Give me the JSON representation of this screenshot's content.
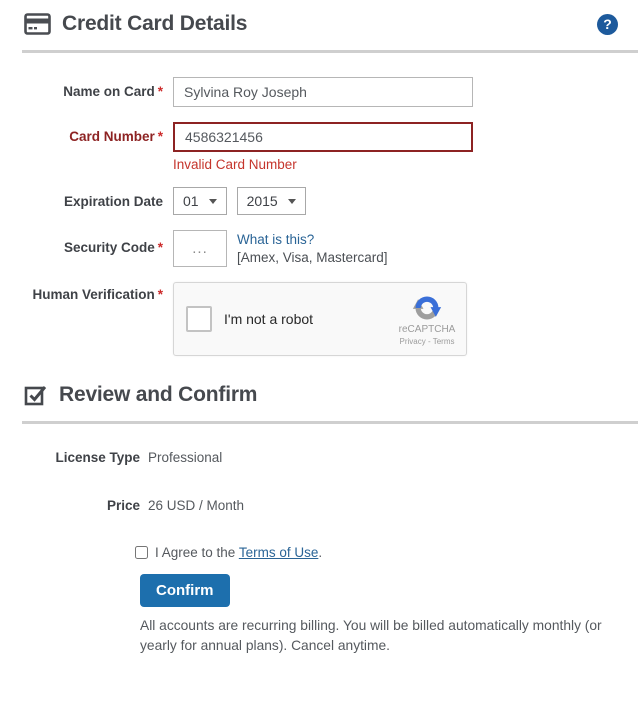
{
  "header": {
    "title": "Credit Card Details",
    "help_icon": "?"
  },
  "form": {
    "name_on_card": {
      "label": "Name on Card",
      "required": "*",
      "value": "Sylvina Roy Joseph"
    },
    "card_number": {
      "label": "Card Number",
      "required": "*",
      "value": "4586321456",
      "error": "Invalid Card Number"
    },
    "expiration": {
      "label": "Expiration Date",
      "month": "01",
      "year": "2015"
    },
    "security_code": {
      "label": "Security Code",
      "required": "*",
      "placeholder": "...",
      "help_link": "What is this?",
      "help_note": "[Amex, Visa, Mastercard]"
    },
    "human_verification": {
      "label": "Human Verification",
      "required": "*"
    }
  },
  "recaptcha": {
    "checkbox_label": "I'm not a robot",
    "brand": "reCAPTCHA",
    "privacy_link": "Privacy",
    "separator": " - ",
    "terms_link": "Terms"
  },
  "review": {
    "title": "Review and Confirm",
    "license_type": {
      "label": "License Type",
      "value": "Professional"
    },
    "price": {
      "label": "Price",
      "value": "26 USD / Month"
    },
    "agree_prefix": "I Agree to the ",
    "terms_link": "Terms of Use",
    "agree_suffix": ".",
    "confirm_label": "Confirm",
    "note": "All accounts are recurring billing. You will be billed automatically monthly (or yearly for annual plans). Cancel anytime."
  },
  "colors": {
    "accent_blue": "#1d6fad",
    "help_blue": "#1d5a9c",
    "link_blue": "#2a6496",
    "error_red": "#c5352c",
    "error_border": "#8d2323",
    "heading_gray": "#46494e",
    "divider_gray": "#cfcfcf"
  }
}
